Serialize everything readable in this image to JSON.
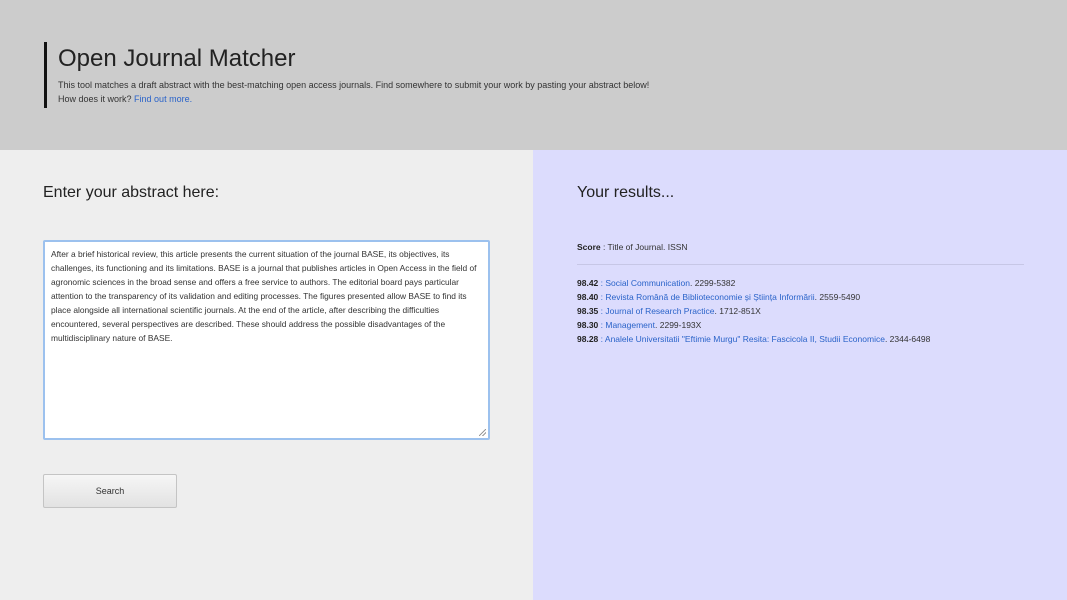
{
  "header": {
    "title": "Open Journal Matcher",
    "description": "This tool matches a draft abstract with the best-matching open access journals. Find somewhere to submit your work by pasting your abstract below!",
    "how_text": "How does it work?",
    "find_out_more": "Find out more."
  },
  "input_panel": {
    "heading": "Enter your abstract here:",
    "abstract_text": "After a brief historical review, this article presents the current situation of the journal BASE, its objectives, its challenges, its functioning and its limitations. BASE is a journal that publishes articles in Open Access in the field of agronomic sciences in the broad sense and offers a free service to authors. The editorial board pays particular attention to the transparency of its validation and editing processes. The figures presented allow BASE to find its place alongside all international scientific journals. At the end of the article, after describing the difficulties encountered, several perspectives are described. These should address the possible disadvantages of the multidisciplinary nature of BASE.",
    "search_label": "Search"
  },
  "results_panel": {
    "heading": "Your results...",
    "legend_score": "Score",
    "legend_rest": " : Title of Journal. ISSN",
    "results": [
      {
        "score": "98.42",
        "journal": "Social Communication",
        "issn": "2299-5382"
      },
      {
        "score": "98.40",
        "journal": "Revista Română de Biblioteconomie și Știința Informării",
        "issn": "2559-5490"
      },
      {
        "score": "98.35",
        "journal": "Journal of Research Practice",
        "issn": "1712-851X"
      },
      {
        "score": "98.30",
        "journal": "Management",
        "issn": "2299-193X"
      },
      {
        "score": "98.28",
        "journal": "Analele Universitatii \"Eftimie Murgu\" Resita: Fascicola II, Studii Economice",
        "issn": "2344-6498"
      }
    ]
  }
}
